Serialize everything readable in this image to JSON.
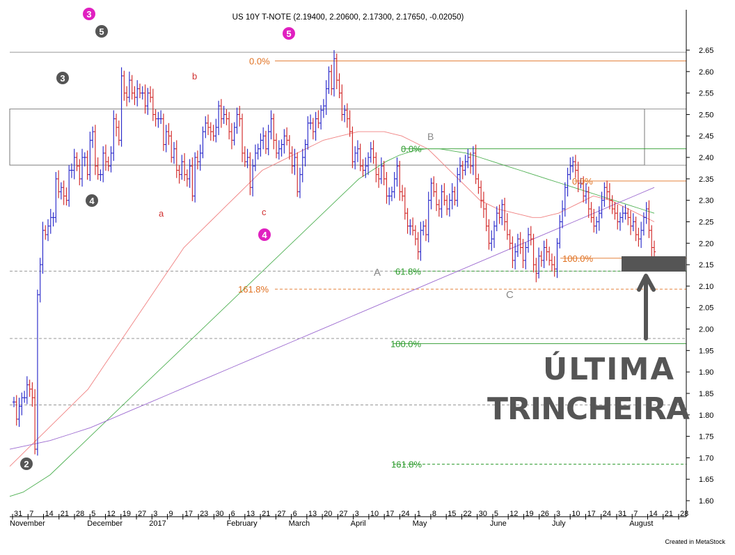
{
  "chart_data": {
    "type": "ohlc-bar",
    "title": "US 10Y T-NOTE (2.19400, 2.20600, 2.17300, 2.17650, -0.02050)",
    "credit": "Created in MetaStock",
    "yaxis": {
      "ticks": [
        "2.65",
        "2.60",
        "2.55",
        "2.50",
        "2.45",
        "2.40",
        "2.35",
        "2.30",
        "2.25",
        "2.20",
        "2.15",
        "2.10",
        "2.05",
        "2.00",
        "1.95",
        "1.90",
        "1.85",
        "1.80",
        "1.75",
        "1.70",
        "1.65",
        "1.60"
      ],
      "ylim": [
        1.57,
        2.7
      ]
    },
    "xaxis": {
      "date_ticks": [
        "31",
        "7",
        "14",
        "21",
        "28",
        "5",
        "12",
        "19",
        "27",
        "3",
        "9",
        "17",
        "23",
        "30",
        "6",
        "13",
        "21",
        "27",
        "6",
        "13",
        "20",
        "27",
        "3",
        "10",
        "17",
        "24",
        "1",
        "8",
        "15",
        "22",
        "30",
        "5",
        "12",
        "19",
        "26",
        "3",
        "10",
        "17",
        "24",
        "31",
        "7",
        "14",
        "21",
        "28"
      ],
      "month_labels": [
        "November",
        "December",
        "2017",
        "February",
        "March",
        "April",
        "May",
        "June",
        "July",
        "August"
      ]
    },
    "price_bars": {
      "x_start_date": "2016-10-31",
      "x_step_days": 1,
      "closes": [
        1.83,
        1.79,
        1.82,
        1.84,
        1.84,
        1.87,
        1.86,
        1.84,
        1.72,
        2.08,
        2.15,
        2.23,
        2.22,
        2.24,
        2.26,
        2.26,
        2.35,
        2.32,
        2.33,
        2.31,
        2.3,
        2.37,
        2.37,
        2.4,
        2.38,
        2.35,
        2.4,
        2.4,
        2.36,
        2.44,
        2.46,
        2.38,
        2.36,
        2.36,
        2.41,
        2.39,
        2.38,
        2.41,
        2.49,
        2.47,
        2.44,
        2.59,
        2.55,
        2.54,
        2.58,
        2.55,
        2.54,
        2.56,
        2.55,
        2.55,
        2.52,
        2.55,
        2.54,
        2.5,
        2.49,
        2.49,
        2.49,
        2.43,
        2.46,
        2.45,
        2.4,
        2.42,
        2.37,
        2.36,
        2.39,
        2.36,
        2.35,
        2.38,
        2.31,
        2.4,
        2.39,
        2.41,
        2.46,
        2.48,
        2.47,
        2.46,
        2.45,
        2.47,
        2.52,
        2.49,
        2.5,
        2.49,
        2.46,
        2.44,
        2.47,
        2.5,
        2.49,
        2.41,
        2.39,
        2.4,
        2.33,
        2.38,
        2.41,
        2.42,
        2.44,
        2.45,
        2.42,
        2.46,
        2.49,
        2.44,
        2.41,
        2.42,
        2.43,
        2.45,
        2.44,
        2.41,
        2.38,
        2.4,
        2.32,
        2.36,
        2.4,
        2.43,
        2.48,
        2.48,
        2.46,
        2.49,
        2.48,
        2.51,
        2.52,
        2.56,
        2.6,
        2.56,
        2.63,
        2.58,
        2.55,
        2.5,
        2.51,
        2.49,
        2.46,
        2.39,
        2.41,
        2.42,
        2.38,
        2.37,
        2.38,
        2.4,
        2.42,
        2.4,
        2.36,
        2.35,
        2.38,
        2.35,
        2.31,
        2.31,
        2.32,
        2.35,
        2.38,
        2.32,
        2.31,
        2.27,
        2.24,
        2.24,
        2.23,
        2.21,
        2.18,
        2.23,
        2.24,
        2.22,
        2.3,
        2.34,
        2.32,
        2.29,
        2.28,
        2.32,
        2.3,
        2.28,
        2.3,
        2.32,
        2.3,
        2.36,
        2.38,
        2.37,
        2.39,
        2.4,
        2.38,
        2.41,
        2.35,
        2.33,
        2.3,
        2.28,
        2.24,
        2.2,
        2.21,
        2.24,
        2.27,
        2.26,
        2.29,
        2.25,
        2.22,
        2.2,
        2.16,
        2.18,
        2.21,
        2.19,
        2.16,
        2.19,
        2.22,
        2.21,
        2.15,
        2.13,
        2.17,
        2.16,
        2.19,
        2.18,
        2.16,
        2.15,
        2.14,
        2.2,
        2.25,
        2.28,
        2.33,
        2.36,
        2.38,
        2.39,
        2.37,
        2.34,
        2.34,
        2.31,
        2.32,
        2.28,
        2.26,
        2.24,
        2.25,
        2.27,
        2.3,
        2.33,
        2.32,
        2.3,
        2.28,
        2.27,
        2.25,
        2.26,
        2.27,
        2.27,
        2.26,
        2.24,
        2.25,
        2.22,
        2.21,
        2.23,
        2.26,
        2.28,
        2.23,
        2.19,
        2.18
      ]
    },
    "moving_averages": [
      {
        "color": "#f08080",
        "values": [
          1.68,
          1.7,
          1.72,
          1.74,
          1.76,
          1.78,
          1.8,
          1.82,
          1.84,
          1.86,
          1.89,
          1.92,
          1.95,
          1.98,
          2.01,
          2.04,
          2.07,
          2.1,
          2.13,
          2.16,
          2.19,
          2.21,
          2.23,
          2.25,
          2.27,
          2.29,
          2.31,
          2.33,
          2.35,
          2.37,
          2.38,
          2.39,
          2.4,
          2.41,
          2.42,
          2.43,
          2.44,
          2.445,
          2.45,
          2.455,
          2.46,
          2.46,
          2.46,
          2.46,
          2.455,
          2.45,
          2.44,
          2.43,
          2.42,
          2.4,
          2.38,
          2.36,
          2.34,
          2.32,
          2.3,
          2.29,
          2.28,
          2.275,
          2.27,
          2.265,
          2.26,
          2.26,
          2.265,
          2.27,
          2.28,
          2.29,
          2.3,
          2.31,
          2.305,
          2.3,
          2.29,
          2.28,
          2.27,
          2.26,
          2.25
        ]
      },
      {
        "color": "#4caf50",
        "values": [
          1.61,
          1.62,
          1.64,
          1.66,
          1.69,
          1.72,
          1.75,
          1.78,
          1.81,
          1.84,
          1.87,
          1.9,
          1.93,
          1.96,
          1.99,
          2.02,
          2.05,
          2.08,
          2.11,
          2.14,
          2.17,
          2.2,
          2.23,
          2.26,
          2.29,
          2.32,
          2.35,
          2.37,
          2.39,
          2.405,
          2.415,
          2.42,
          2.42,
          2.415,
          2.41,
          2.4,
          2.39,
          2.38,
          2.37,
          2.36,
          2.35,
          2.34,
          2.33,
          2.32,
          2.31,
          2.3,
          2.29,
          2.28,
          2.27
        ]
      },
      {
        "color": "#9c6ad0",
        "values": [
          1.72,
          1.73,
          1.74,
          1.755,
          1.77,
          1.79,
          1.81,
          1.83,
          1.85,
          1.87,
          1.89,
          1.91,
          1.93,
          1.95,
          1.97,
          1.99,
          2.01,
          2.03,
          2.05,
          2.07,
          2.09,
          2.11,
          2.13,
          2.15,
          2.17,
          2.19,
          2.21,
          2.23,
          2.25,
          2.27,
          2.29,
          2.31,
          2.33
        ]
      }
    ],
    "horizontal_levels": [
      {
        "value": 2.645,
        "style": "solid",
        "color": "#888888"
      },
      {
        "value": 2.625,
        "style": "solid",
        "color": "#e07020"
      },
      {
        "value": 2.513,
        "style": "solid",
        "color": "#888888"
      },
      {
        "value": 2.42,
        "style": "solid",
        "color": "#2a9a2a"
      },
      {
        "value": 2.382,
        "style": "solid",
        "color": "#888888"
      },
      {
        "value": 2.345,
        "style": "solid",
        "color": "#e07020"
      },
      {
        "value": 2.165,
        "style": "solid",
        "color": "#e07020"
      },
      {
        "value": 2.135,
        "style": "dashed",
        "color": "#888888"
      },
      {
        "value": 2.135,
        "style": "dashed",
        "color": "#2a9a2a"
      },
      {
        "value": 2.093,
        "style": "dashed",
        "color": "#e07020"
      },
      {
        "value": 1.978,
        "style": "dashed",
        "color": "#888888"
      },
      {
        "value": 1.966,
        "style": "solid",
        "color": "#2a9a2a"
      },
      {
        "value": 1.823,
        "style": "dashed",
        "color": "#888888"
      },
      {
        "value": 1.685,
        "style": "dashed",
        "color": "#2a9a2a"
      }
    ],
    "fib_labels": [
      {
        "text": "0.0%",
        "color": "#e07020"
      },
      {
        "text": "161.8%",
        "color": "#e07020"
      },
      {
        "text": "0.0%",
        "color": "#2a9a2a"
      },
      {
        "text": "61.8%",
        "color": "#2a9a2a"
      },
      {
        "text": "100.0%",
        "color": "#2a9a2a"
      },
      {
        "text": "161.8%",
        "color": "#2a9a2a"
      },
      {
        "text": "0.0%",
        "color": "#e07020"
      },
      {
        "text": "100.0%",
        "color": "#e07020"
      }
    ],
    "wave_labels": [
      {
        "text": "a",
        "color": "#d03030"
      },
      {
        "text": "b",
        "color": "#d03030"
      },
      {
        "text": "c",
        "color": "#d03030"
      },
      {
        "text": "A",
        "color": "#888888"
      },
      {
        "text": "B",
        "color": "#888888"
      },
      {
        "text": "C",
        "color": "#888888"
      }
    ],
    "wave_circles": [
      {
        "text": "3",
        "color": "#e020c0"
      },
      {
        "text": "5",
        "color": "#555555"
      },
      {
        "text": "3",
        "color": "#555555"
      },
      {
        "text": "4",
        "color": "#555555"
      },
      {
        "text": "2",
        "color": "#555555"
      },
      {
        "text": "5",
        "color": "#e020c0"
      },
      {
        "text": "4",
        "color": "#e020c0"
      }
    ],
    "annotation": {
      "line1": "ÚLTIMA",
      "line2": "TRINCHEIRA"
    },
    "colors": {
      "up": "#2020c8",
      "down": "#d02020",
      "annotation": "#555555"
    }
  }
}
